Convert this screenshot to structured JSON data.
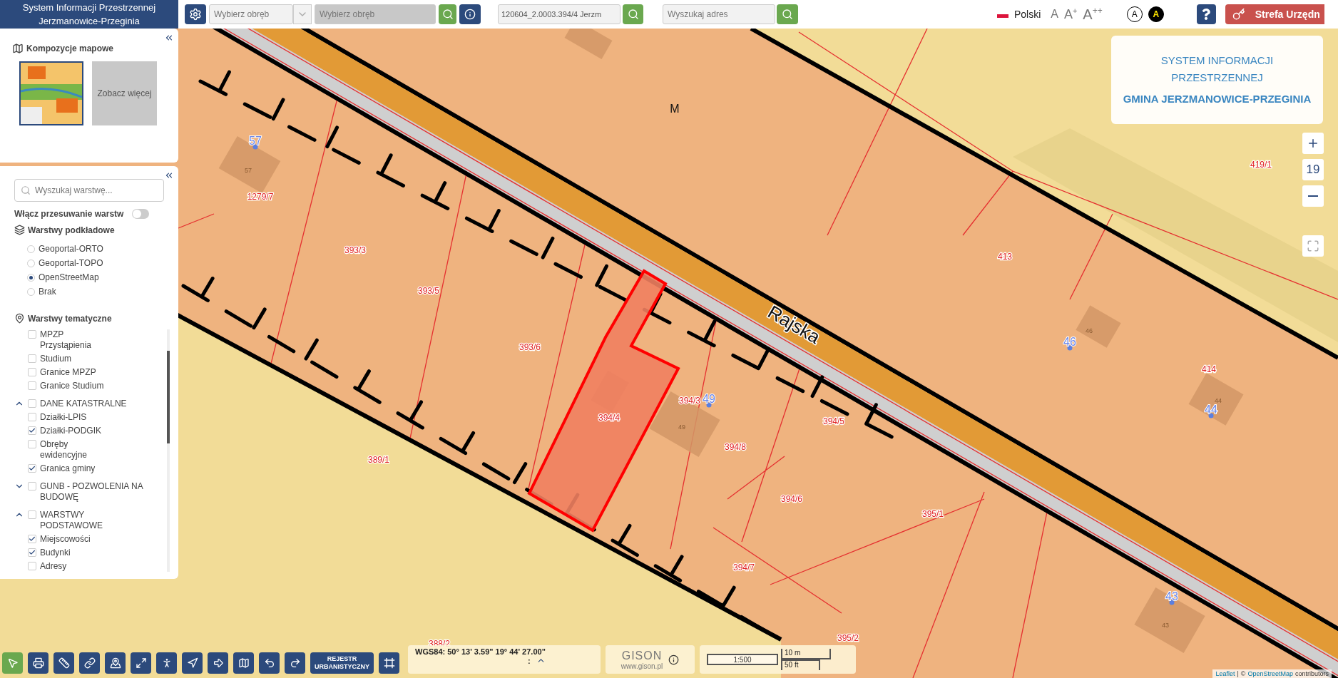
{
  "header": {
    "title_lines": [
      "System Informacji Przestrzennej",
      "Jerzmanowice-Przeginia"
    ],
    "precinct_select": {
      "placeholder": "Wybierz obręb"
    },
    "sheet_select": {
      "placeholder": "Wybierz obręb",
      "disabled": true
    },
    "parcel_search": {
      "value": "120604_2.0003.394/4 Jerzm"
    },
    "address_search": {
      "placeholder": "Wyszukaj adres"
    },
    "language": "Polski",
    "font_sizes": [
      "A",
      "A$^{+}$",
      "A$^{++}$"
    ],
    "contrast": [
      {
        "label": "A",
        "kind": "normal"
      },
      {
        "label": "A",
        "kind": "high"
      }
    ],
    "login_button": "Strefa Urzędn"
  },
  "compositions": {
    "title": "Kompozycje mapowe",
    "items": [
      {
        "selected": true
      }
    ],
    "more": "Zobacz więcej"
  },
  "layers_panel": {
    "search_placeholder": "Wyszukaj warstwę...",
    "shift_toggle": {
      "label": "Włącz przesuwanie warstw",
      "on": false
    },
    "base_title": "Warstwy podkładowe",
    "base_layers": [
      {
        "label": "Geoportal-ORTO",
        "selected": false
      },
      {
        "label": "Geoportal-TOPO",
        "selected": false
      },
      {
        "label": "OpenStreetMap",
        "selected": true
      },
      {
        "label": "Brak",
        "selected": false
      }
    ],
    "thematic_title": "Warstwy tematyczne",
    "thematic_layers": [
      {
        "kind": "layer",
        "label": "MPZP Przystąpienia",
        "checked": false
      },
      {
        "kind": "layer",
        "label": "Studium",
        "checked": false
      },
      {
        "kind": "layer",
        "label": "Granice MPZP",
        "checked": false
      },
      {
        "kind": "layer",
        "label": "Granice Studium",
        "checked": false
      },
      {
        "kind": "group",
        "label": "DANE KATASTRALNE",
        "checked": false,
        "expanded": true,
        "children": [
          {
            "kind": "layer",
            "label": "Działki-LPIS",
            "checked": false
          },
          {
            "kind": "layer",
            "label": "Działki-PODGIK",
            "checked": true
          },
          {
            "kind": "layer",
            "label": "Obręby ewidencyjne",
            "checked": false
          },
          {
            "kind": "layer",
            "label": "Granica gminy",
            "checked": true
          }
        ]
      },
      {
        "kind": "group",
        "label": "GUNB - POZWOLENIA NA BUDOWĘ",
        "checked": false,
        "expanded": false
      },
      {
        "kind": "group",
        "label": "WARSTWY PODSTAWOWE",
        "checked": false,
        "expanded": true,
        "children": [
          {
            "kind": "layer",
            "label": "Miejscowości",
            "checked": true
          },
          {
            "kind": "layer",
            "label": "Budynki",
            "checked": true
          },
          {
            "kind": "layer",
            "label": "Adresy",
            "checked": false
          }
        ]
      }
    ]
  },
  "map": {
    "labels": [
      {
        "kind": "place",
        "text": "M"
      },
      {
        "kind": "address",
        "text": "57"
      },
      {
        "kind": "building",
        "text": "57"
      },
      {
        "kind": "parcel",
        "text": "1279/7"
      },
      {
        "kind": "parcel",
        "text": "393/3"
      },
      {
        "kind": "parcel",
        "text": "393/5"
      },
      {
        "kind": "parcel",
        "text": "393/6"
      },
      {
        "kind": "parcel",
        "text": "394/4"
      },
      {
        "kind": "parcel",
        "text": "394/3"
      },
      {
        "kind": "address",
        "text": "49"
      },
      {
        "kind": "building",
        "text": "49"
      },
      {
        "kind": "parcel",
        "text": "394/5"
      },
      {
        "kind": "parcel",
        "text": "394/8"
      },
      {
        "kind": "parcel",
        "text": "389/1"
      },
      {
        "kind": "parcel",
        "text": "394/6"
      },
      {
        "kind": "parcel",
        "text": "395/1"
      },
      {
        "kind": "parcel",
        "text": "394/7"
      },
      {
        "kind": "parcel",
        "text": "413"
      },
      {
        "kind": "address",
        "text": "46"
      },
      {
        "kind": "building",
        "text": "46"
      },
      {
        "kind": "parcel",
        "text": "414"
      },
      {
        "kind": "address",
        "text": "44"
      },
      {
        "kind": "building",
        "text": "44"
      },
      {
        "kind": "parcel",
        "text": "419/1"
      },
      {
        "kind": "address",
        "text": "43"
      },
      {
        "kind": "building",
        "text": "43"
      },
      {
        "kind": "parcel",
        "text": "388/2"
      },
      {
        "kind": "parcel",
        "text": "395/2"
      },
      {
        "kind": "street",
        "text": "Rajska"
      }
    ]
  },
  "info_card": {
    "lines": [
      "SYSTEM INFORMACJI",
      "PRZESTRZENNEJ"
    ],
    "title": "GMINA JERZMANOWICE-PRZEGINIA"
  },
  "zoom": {
    "value": "19"
  },
  "toolbar": {
    "tools": [
      {
        "kind": "icon",
        "selected": true
      },
      {
        "kind": "icon",
        "selected": false
      },
      {
        "kind": "icon",
        "selected": false
      },
      {
        "kind": "icon",
        "selected": false
      },
      {
        "kind": "icon",
        "selected": false
      },
      {
        "kind": "icon",
        "selected": false
      },
      {
        "kind": "icon",
        "selected": false
      },
      {
        "kind": "icon",
        "selected": false
      },
      {
        "kind": "icon",
        "selected": false
      },
      {
        "kind": "icon",
        "selected": false
      },
      {
        "kind": "icon",
        "selected": false
      },
      {
        "kind": "icon",
        "selected": false
      },
      {
        "kind": "text",
        "label": "REJESTR URBANISTYCZNY",
        "selected": false
      },
      {
        "kind": "icon",
        "selected": false
      }
    ]
  },
  "coordinates": {
    "text": "**WGS84:** 50° 13' 3.59\" 19° 44' 27.00\"",
    "separator": ":"
  },
  "brand": {
    "name": "GISON",
    "url": "www.gison.pl"
  },
  "scale": {
    "ratio": "1:500",
    "metric": "10 m",
    "imperial": "50 ft"
  },
  "attribution": {
    "link": "Leaflet",
    "separator": "|",
    "credit": "©",
    "osm": "OpenStreetMap",
    "suffix": "contributors"
  }
}
